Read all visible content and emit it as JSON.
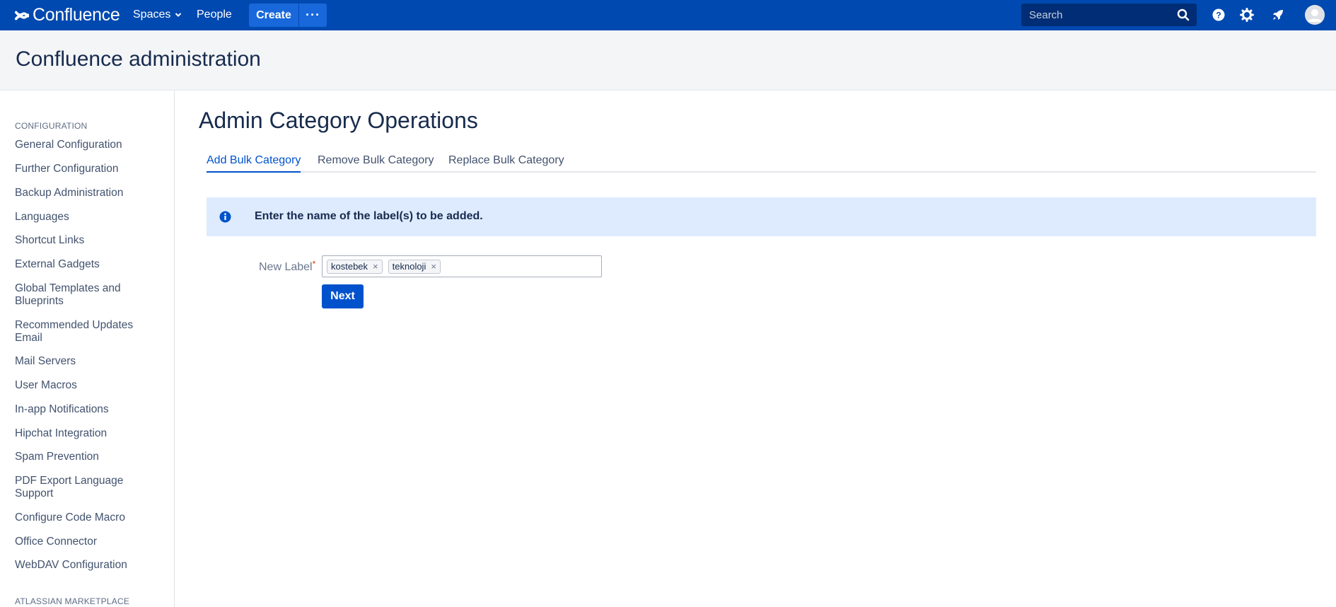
{
  "topbar": {
    "logo_text": "Confluence",
    "nav": {
      "spaces": "Spaces",
      "people": "People"
    },
    "create_label": "Create",
    "more_label": "···",
    "search_placeholder": "Search",
    "colors": {
      "bar": "#0049b0",
      "create": "#1868db"
    }
  },
  "page_header": {
    "title": "Confluence administration"
  },
  "sidebar": {
    "heading_configuration": "CONFIGURATION",
    "items": [
      "General Configuration",
      "Further Configuration",
      "Backup Administration",
      "Languages",
      "Shortcut Links",
      "External Gadgets",
      "Global Templates and Blueprints",
      "Recommended Updates Email",
      "Mail Servers",
      "User Macros",
      "In-app Notifications",
      "Hipchat Integration",
      "Spam Prevention",
      "PDF Export Language Support",
      "Configure Code Macro",
      "Office Connector",
      "WebDAV Configuration"
    ],
    "heading_marketplace": "ATLASSIAN MARKETPLACE"
  },
  "main": {
    "title": "Admin Category Operations",
    "tabs": [
      {
        "label": "Add Bulk Category",
        "active": true
      },
      {
        "label": "Remove Bulk Category",
        "active": false
      },
      {
        "label": "Replace Bulk Category",
        "active": false
      }
    ],
    "info_message": "Enter the name of the label(s) to be added.",
    "form": {
      "label": "New Label",
      "required_mark": "*",
      "chips": [
        "kostebek",
        "teknoloji"
      ],
      "chip_remove": "×",
      "next_label": "Next"
    }
  }
}
